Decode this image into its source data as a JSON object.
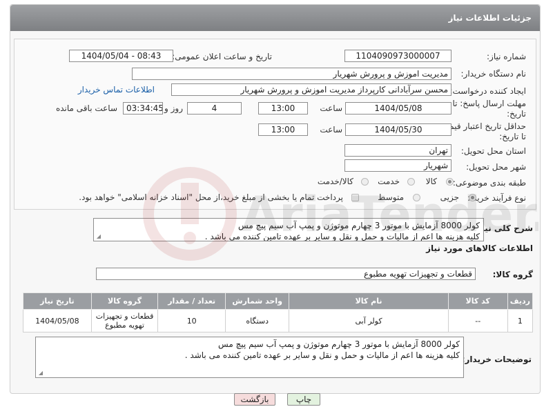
{
  "header": {
    "title": "جزئیات اطلاعات نیاز"
  },
  "form": {
    "need_number": {
      "label": "شماره نیاز:",
      "value": "1104090973000007"
    },
    "announce_datetime": {
      "label": "تاریخ و ساعت اعلان عمومی:",
      "value": "1404/05/04 - 08:43"
    },
    "buyer_org": {
      "label": "نام دستگاه خریدار:",
      "value": "مدیریت اموزش و پرورش شهریار"
    },
    "creator": {
      "label": "ایجاد کننده درخواست:",
      "value": "محسن سرآبادانی کارپرداز مدیریت اموزش و پرورش شهریار",
      "contact_link": "اطلاعات تماس خریدار"
    },
    "reply_deadline": {
      "label_line1": "مهلت ارسال پاسخ: تا",
      "label_line2": "تاریخ:",
      "date": "1404/05/08",
      "time_label": "ساعت",
      "time": "13:00",
      "days": "4",
      "days_label": "روز و",
      "remaining": "03:34:45",
      "remaining_label": "ساعت باقی مانده"
    },
    "price_validity": {
      "label_line1": "حداقل تاریخ اعتبار قیمت:",
      "label_line2": "تا تاریخ:",
      "date": "1404/05/30",
      "time_label": "ساعت",
      "time": "13:00"
    },
    "province": {
      "label": "استان محل تحویل:",
      "value": "تهران"
    },
    "city": {
      "label": "شهر محل تحویل:",
      "value": "شهریار"
    },
    "category": {
      "label": "طبقه بندی موضوعی:",
      "options": [
        "کالا",
        "خدمت",
        "کالا/خدمت"
      ],
      "selected": "کالا"
    },
    "purchase_process": {
      "label": "نوع فرآیند خرید :",
      "options": [
        "جزیی",
        "متوسط"
      ],
      "selected": "جزیی",
      "payment_note": "پرداخت تمام یا بخشی از مبلغ خرید،از محل \"اسناد خزانه اسلامی\" خواهد بود."
    }
  },
  "description": {
    "label": "شرح کلی نیاز:",
    "line1": "کولر 8000 آزمایش  با موتور 3 چهارم موتوژن و پمپ آب سیم پیچ مس",
    "line2": "کلیه هزینه ها اعم از مالیات و حمل و نقل و سایر بر عهده تامین کننده می باشد ."
  },
  "goods_section": {
    "title": "اطلاعات کالاهای مورد نیاز",
    "group_label": "گروه کالا:",
    "group_value": "قطعات و تجهیزات تهویه مطبوع"
  },
  "items_table": {
    "headers": [
      "ردیف",
      "کد کالا",
      "نام کالا",
      "واحد شمارش",
      "تعداد / مقدار",
      "گروه کالا",
      "تاریخ نیاز"
    ],
    "rows": [
      {
        "row": "1",
        "code": "--",
        "name": "کولر آبی",
        "unit": "دستگاه",
        "qty": "10",
        "group_line1": "قطعات و تجهیزات",
        "group_line2": "تهویه مطبوع",
        "date": "1404/05/08"
      }
    ]
  },
  "buyer_notes": {
    "label": "توضیحات خریدار:",
    "line1": "کولر 8000 آزمایش  با موتور 3 چهارم موتوژن و پمپ آب سیم پیچ مس",
    "line2": "کلیه هزینه ها اعم از مالیات و حمل و نقل و سایر بر عهده تامین کننده می باشد ."
  },
  "buttons": {
    "print": "چاپ",
    "back": "بازگشت"
  },
  "watermark": {
    "text": "AriaTender.neT"
  },
  "colors": {
    "titlebar": "#8e9093",
    "link": "#1a5fa8",
    "table_header": "#9b9ea2",
    "back_button": "#f6dcdc",
    "print_button": "#e3f2df"
  }
}
